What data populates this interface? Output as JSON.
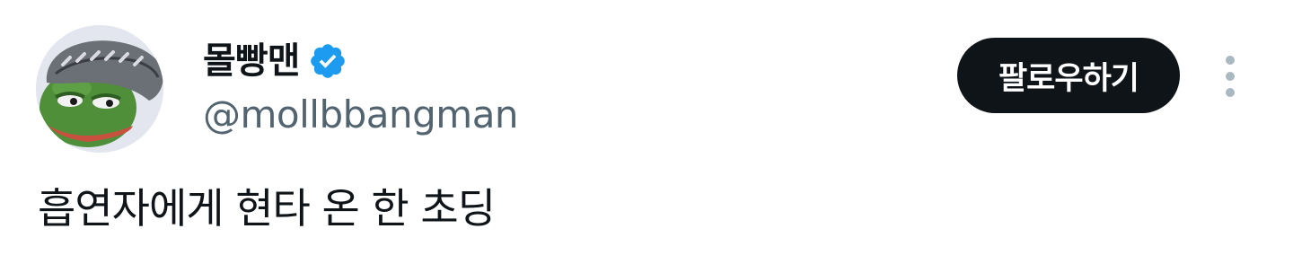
{
  "author": {
    "display_name": "몰빵맨",
    "handle": "@mollbbangman",
    "verified": true
  },
  "follow_button_label": "팔로우하기",
  "tweet": {
    "text": "흡연자에게 현타 온 한 초딩"
  },
  "colors": {
    "text_primary": "#0f1419",
    "text_secondary": "#536471",
    "verified_badge": "#1d9bf0",
    "button_background": "#0f1419",
    "button_text": "#ffffff",
    "avatar_background": "#e3e6ee"
  },
  "icons": {
    "avatar": "pepe-frog-pompadour-avatar",
    "verified": "verified-badge-icon",
    "more": "more-vertical-icon"
  }
}
